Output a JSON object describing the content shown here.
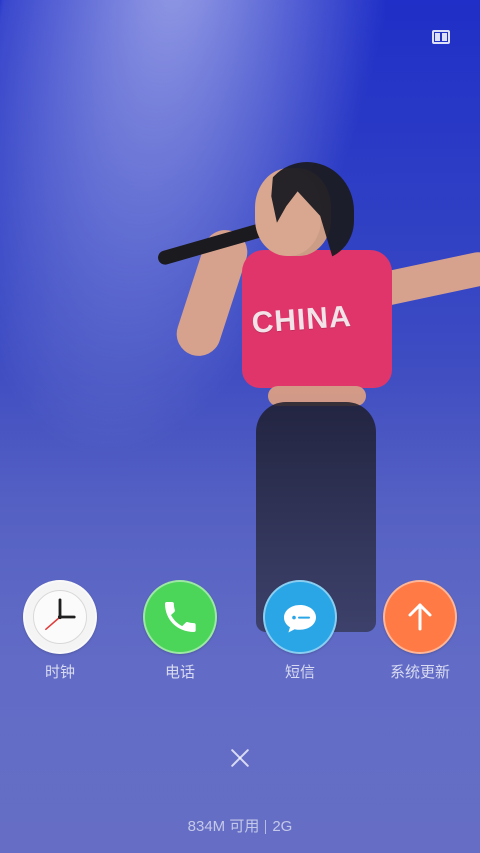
{
  "apps": [
    {
      "label": "时钟",
      "icon": "clock-icon",
      "color": "#f2f2f2"
    },
    {
      "label": "电话",
      "icon": "phone-icon",
      "color": "#4bd65a"
    },
    {
      "label": "短信",
      "icon": "sms-icon",
      "color": "#2aa6e6"
    },
    {
      "label": "系统更新",
      "icon": "arrow-up-icon",
      "color": "#ff7a45"
    }
  ],
  "status": {
    "memory_text": "834M 可用",
    "network_text": "2G"
  },
  "artwork": {
    "shirt_text": "CHINA"
  }
}
